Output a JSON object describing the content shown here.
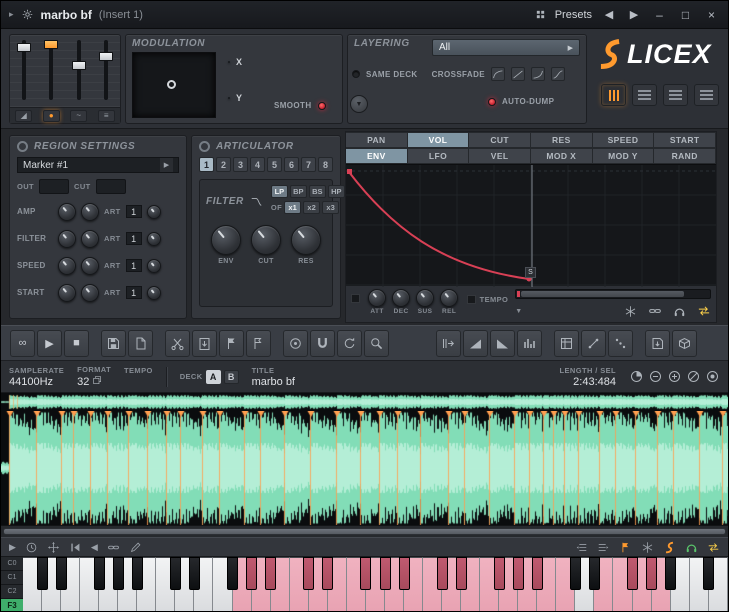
{
  "titlebar": {
    "menu_arrow": "▸",
    "title": "marbo bf",
    "context": "(Insert 1)",
    "presets_label": "Presets",
    "prev_arrow": "◀",
    "next_arrow": "▶",
    "minimize": "–",
    "maximize": "□",
    "close": "×"
  },
  "mixer": {
    "icons": [
      "◢",
      "●",
      "~",
      "≡"
    ]
  },
  "modulation": {
    "header": "MODULATION",
    "x_label": "X",
    "y_label": "Y",
    "smooth_label": "SMOOTH"
  },
  "layering": {
    "header": "LAYERING",
    "selected": "All",
    "dropdown_arrow": "▶",
    "same_deck_label": "SAME DECK",
    "crossfade_label": "CROSSFADE",
    "auto_dump_label": "AUTO-DUMP",
    "drop_glyph": "▼"
  },
  "logo": {
    "text": "LICEX"
  },
  "region": {
    "header": "REGION SETTINGS",
    "selector": "Marker #1",
    "selector_arrow": "▶",
    "out_label": "OUT",
    "cut_label": "CUT",
    "rows": [
      {
        "label": "AMP",
        "art_label": "ART",
        "value": "1"
      },
      {
        "label": "FILTER",
        "art_label": "ART",
        "value": "1"
      },
      {
        "label": "SPEED",
        "art_label": "ART",
        "value": "1"
      },
      {
        "label": "START",
        "art_label": "ART",
        "value": "1"
      }
    ]
  },
  "articulator": {
    "header": "ARTICULATOR",
    "slots": [
      "1",
      "2",
      "3",
      "4",
      "5",
      "6",
      "7",
      "8"
    ],
    "active_slot": "1",
    "filter": {
      "header": "FILTER",
      "modes": [
        "LP",
        "BP",
        "BS",
        "HP"
      ],
      "active_mode": "LP",
      "of_label": "OF",
      "oversample": [
        "x1",
        "x2",
        "x3"
      ],
      "active_oversample": "x1",
      "knob_labels": [
        "ENV",
        "CUT",
        "RES"
      ]
    }
  },
  "envelope": {
    "tabs_top": [
      "PAN",
      "VOL",
      "CUT",
      "RES",
      "SPEED",
      "START"
    ],
    "active_top": "VOL",
    "tabs_bottom": [
      "ENV",
      "LFO",
      "VEL",
      "MOD X",
      "MOD Y",
      "RAND"
    ],
    "active_bottom": "ENV",
    "sustain_label": "S",
    "knob_labels": [
      "ATT",
      "DEC",
      "SUS",
      "REL"
    ],
    "tempo_label": "TEMPO",
    "chevron": "▼"
  },
  "toolbar": {
    "buttons": [
      {
        "name": "loop-mode-button",
        "glyph": "∞",
        "group": 0
      },
      {
        "name": "play-button",
        "glyph": "▶",
        "group": 0
      },
      {
        "name": "stop-button",
        "glyph": "■",
        "group": 0
      },
      {
        "name": "save-sample-button",
        "icon": "floppy",
        "group": 1
      },
      {
        "name": "new-document-button",
        "icon": "page",
        "group": 1
      },
      {
        "name": "cut-button",
        "icon": "scissors",
        "group": 2
      },
      {
        "name": "paste-button",
        "icon": "paste",
        "group": 2
      },
      {
        "name": "drop-marker-button",
        "icon": "flag",
        "group": 2
      },
      {
        "name": "auto-slice-button",
        "icon": "flagauto",
        "group": 2
      },
      {
        "name": "declick-button",
        "icon": "disc",
        "group": 3
      },
      {
        "name": "snap-magnet-button",
        "icon": "magnet",
        "group": 3
      },
      {
        "name": "reanalyze-button",
        "icon": "refresh",
        "group": 3
      },
      {
        "name": "zoom-tool-button",
        "icon": "zoom",
        "group": 3
      },
      {
        "name": "send-to-playlist-button",
        "icon": "sendright",
        "group": 4
      },
      {
        "name": "fade-in-button",
        "icon": "rampup",
        "group": 4
      },
      {
        "name": "fade-out-button",
        "icon": "rampdown",
        "group": 4
      },
      {
        "name": "run-tool-button",
        "icon": "runbars",
        "group": 4
      },
      {
        "name": "edit-grid-button",
        "icon": "gridpencil",
        "group": 5
      },
      {
        "name": "slide-notes-button",
        "icon": "slide",
        "group": 5
      },
      {
        "name": "scatter-button",
        "icon": "dots",
        "group": 5
      },
      {
        "name": "export-sample-button",
        "icon": "savearrow",
        "group": 6
      },
      {
        "name": "browse-samples-button",
        "icon": "box",
        "group": 6
      }
    ]
  },
  "infobar": {
    "samplerate_label": "SAMPLERATE",
    "samplerate_value": "44100Hz",
    "format_label": "FORMAT",
    "format_value": "32",
    "tempo_label": "TEMPO",
    "deck_label": "DECK",
    "deck_a": "A",
    "deck_b": "B",
    "title_label": "TITLE",
    "title_value": "marbo bf",
    "length_label": "LENGTH / SEL",
    "length_value": "2:43:484"
  },
  "bottom_toolbar": {
    "left": [
      {
        "name": "preview-play-button",
        "glyph": "▶"
      },
      {
        "name": "time-clock-button",
        "icon": "clock"
      },
      {
        "name": "drag-pan-button",
        "icon": "move"
      },
      {
        "name": "previous-slice-button",
        "icon": "prev"
      },
      {
        "name": "rewind-button",
        "glyph": "◀"
      },
      {
        "name": "link-lock-button",
        "icon": "link"
      },
      {
        "name": "draw-pencil-button",
        "icon": "pencil"
      }
    ],
    "right": [
      {
        "name": "list-collapse-button",
        "icon": "listl"
      },
      {
        "name": "list-expand-button",
        "icon": "listr"
      },
      {
        "name": "marker-flag-button",
        "icon": "flag",
        "color": "accent"
      },
      {
        "name": "freeze-button",
        "icon": "snow"
      },
      {
        "name": "slicex-tool-button",
        "icon": "scurve",
        "color": "accent"
      },
      {
        "name": "monitor-headphones-button",
        "icon": "headphones",
        "color": "green"
      },
      {
        "name": "swap-channels-button",
        "icon": "swap",
        "color": "yellow"
      }
    ]
  },
  "keys": {
    "octave_labels": [
      "C0",
      "C1",
      "C2"
    ],
    "current_key": "F3",
    "white_count": 37,
    "highlight_ranges": [
      [
        11,
        28
      ],
      [
        30,
        33
      ]
    ]
  },
  "wave": {
    "slice_count": 38
  },
  "colors": {
    "accent": "#ff9a2e",
    "wave": "#8df0c6",
    "wave_dim": "#57c79a",
    "envelope": "#d84055",
    "slice": "#ff9e4f",
    "key_highlight": "#e8a2b2",
    "key_highlight_dark": "#a84a5c",
    "headphones": "#59c26a",
    "swap": "#ffd24a"
  }
}
